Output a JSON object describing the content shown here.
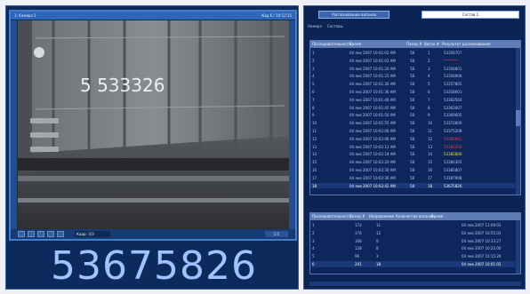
{
  "camera": {
    "title_left": "1: Камера 1",
    "title_right": "Кад 6 / 10:12:15",
    "frame_label": "Кадр: 3/3",
    "zoom_label": "1:1",
    "car_stencil": "5 533326"
  },
  "recognized_number": "53675826",
  "top_panel": {
    "button_label": "Распознавание вагонов",
    "input_value": "Состав 1"
  },
  "tabs": [
    {
      "label": "Номера"
    },
    {
      "label": "Составы"
    }
  ],
  "grid1": {
    "columns": [
      "Последовательность",
      "Время",
      "Поезд #",
      "Вагон #",
      "Результат распознавания"
    ],
    "rows": [
      {
        "seq": "1",
        "time": "04 янв 2007 10:01:02 AM",
        "train": "58",
        "wagon": "1",
        "result": "53356707",
        "color": "#b7c8ee"
      },
      {
        "seq": "2",
        "time": "04 янв 2007 10:01:02 AM",
        "train": "58",
        "wagon": "2",
        "result": "********",
        "color": "#e64040"
      },
      {
        "seq": "3",
        "time": "04 янв 2007 10:01:20 AM",
        "train": "58",
        "wagon": "3",
        "result": "53356801",
        "color": "#b7c8ee"
      },
      {
        "seq": "4",
        "time": "04 янв 2007 10:01:25 AM",
        "train": "58",
        "wagon": "4",
        "result": "53356906",
        "color": "#b7c8ee"
      },
      {
        "seq": "5",
        "time": "04 янв 2007 10:01:30 AM",
        "train": "58",
        "wagon": "5",
        "result": "53357805",
        "color": "#b7c8ee"
      },
      {
        "seq": "6",
        "time": "04 янв 2007 10:01:36 AM",
        "train": "58",
        "wagon": "6",
        "result": "53358601",
        "color": "#b7c8ee"
      },
      {
        "seq": "7",
        "time": "04 янв 2007 10:01:40 AM",
        "train": "58",
        "wagon": "7",
        "result": "53362504",
        "color": "#b7c8ee"
      },
      {
        "seq": "8",
        "time": "04 янв 2007 10:01:45 AM",
        "train": "58",
        "wagon": "8",
        "result": "53363007",
        "color": "#b7c8ee"
      },
      {
        "seq": "9",
        "time": "04 янв 2007 10:01:50 AM",
        "train": "58",
        "wagon": "9",
        "result": "53369605",
        "color": "#b7c8ee"
      },
      {
        "seq": "10",
        "time": "04 янв 2007 10:01:55 AM",
        "train": "58",
        "wagon": "10",
        "result": "53372809",
        "color": "#b7c8ee"
      },
      {
        "seq": "11",
        "time": "04 янв 2007 10:02:00 AM",
        "train": "58",
        "wagon": "11",
        "result": "53375208",
        "color": "#b7c8ee"
      },
      {
        "seq": "12",
        "time": "04 янв 2007 10:02:06 AM",
        "train": "58",
        "wagon": "12",
        "result": "53380901",
        "color": "#e64040"
      },
      {
        "seq": "13",
        "time": "04 янв 2007 10:02:12 AM",
        "train": "58",
        "wagon": "13",
        "result": "53381206",
        "color": "#e64040"
      },
      {
        "seq": "14",
        "time": "04 янв 2007 10:02:18 AM",
        "train": "58",
        "wagon": "14",
        "result": "53382800",
        "color": "#e8e040"
      },
      {
        "seq": "15",
        "time": "04 янв 2007 10:02:24 AM",
        "train": "58",
        "wagon": "15",
        "result": "53384305",
        "color": "#b7c8ee"
      },
      {
        "seq": "16",
        "time": "04 янв 2007 10:02:30 AM",
        "train": "58",
        "wagon": "16",
        "result": "53385807",
        "color": "#b7c8ee"
      },
      {
        "seq": "17",
        "time": "04 янв 2007 10:02:36 AM",
        "train": "58",
        "wagon": "17",
        "result": "53387908",
        "color": "#b7c8ee"
      },
      {
        "seq": "18",
        "time": "04 янв 2007 10:02:42 AM",
        "train": "58",
        "wagon": "18",
        "result": "53675826",
        "color": "#ffffff"
      }
    ]
  },
  "grid2": {
    "columns": [
      "Последовательность",
      "Поезд #",
      "Направление",
      "Количество вагонов",
      "Время"
    ],
    "rows": [
      {
        "seq": "1",
        "train": "173",
        "dir": "11",
        "count": "",
        "time": "04 янв 2007 11:09:03"
      },
      {
        "seq": "2",
        "train": "176",
        "dir": "12",
        "count": "",
        "time": "04 янв 2007 10:55:03"
      },
      {
        "seq": "3",
        "train": "168",
        "dir": "9",
        "count": "",
        "time": "04 янв 2007 10:33:27"
      },
      {
        "seq": "4",
        "train": "128",
        "dir": "8",
        "count": "",
        "time": "04 янв 2007 10:25:00"
      },
      {
        "seq": "5",
        "train": "96",
        "dir": "3",
        "count": "",
        "time": "04 янв 2007 10:15:20"
      },
      {
        "seq": "6",
        "train": "201",
        "dir": "18",
        "count": "",
        "time": "04 янв 2007 10:01:02"
      }
    ]
  },
  "colors": {
    "panel_bg": "#0c2454",
    "header_bg": "#5e7cb6",
    "accent": "#3f7ec9",
    "big_number": "#9fc3ff",
    "error": "#e64040",
    "warning": "#e8e040"
  }
}
